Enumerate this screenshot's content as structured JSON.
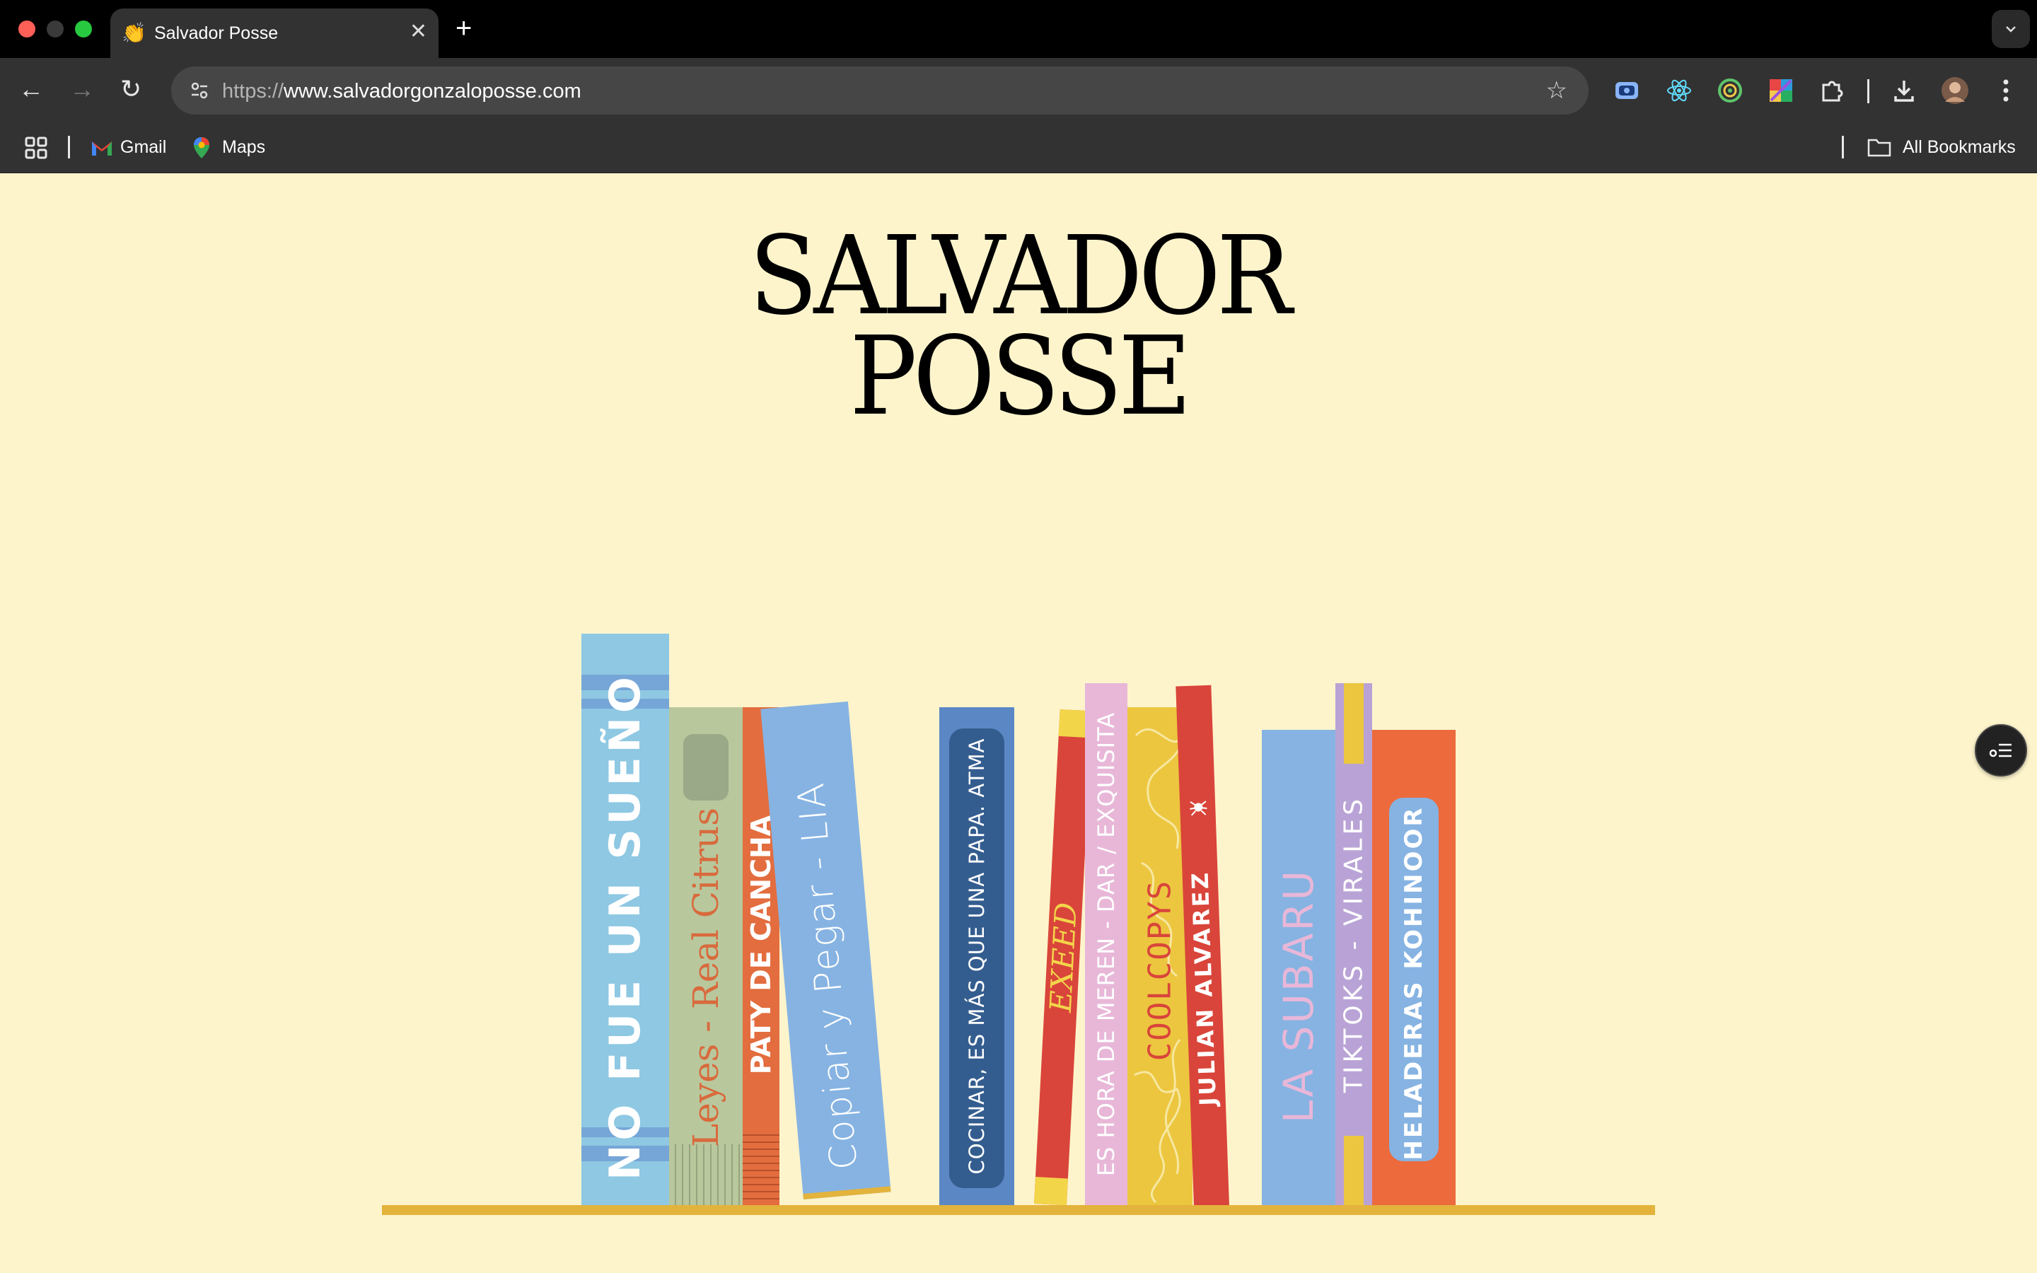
{
  "browser": {
    "tab_title": "Salvador Posse",
    "tab_favicon": "👏",
    "tab_close": "✕",
    "new_tab": "+",
    "tab_menu": "⌄",
    "url_scheme": "https://",
    "url_host": "www.salvadorgonzaloposse.com",
    "nav": {
      "back": "←",
      "forward": "→",
      "reload": "↻"
    },
    "star": "☆",
    "bookmarks": [
      {
        "label": "Gmail"
      },
      {
        "label": "Maps"
      }
    ],
    "all_bookmarks": "All Bookmarks",
    "extension_icons": [
      "screen-capture-icon",
      "react-devtools-icon",
      "circle-target-icon",
      "color-grid-icon",
      "puzzle-extensions-icon",
      "download-icon",
      "profile-avatar",
      "more-menu-icon"
    ]
  },
  "page": {
    "title_line1": "SALVADOR",
    "title_line2": "POSSE",
    "books": [
      {
        "label": "NO FUE UN SUEÑO",
        "color": "#8ec8e3",
        "text_color": "#ffffff"
      },
      {
        "label": "Leyes - Real Citrus",
        "color": "#b9c79d",
        "text_color": "#d86a3c"
      },
      {
        "label": "PATY DE CANCHA",
        "color": "#e36d3e",
        "text_color": "#ffffff"
      },
      {
        "label": "Copiar y Pegar - LIA",
        "color": "#86b3e2",
        "text_color": "#ffffff"
      },
      {
        "label": "COCINAR, ES MÁS QUE UNA PAPA. ATMA",
        "color": "#5b87c5",
        "text_color": "#ffffff"
      },
      {
        "label": "EXEED",
        "color": "#d9453a",
        "text_color": "#f3d54a"
      },
      {
        "label": "ES HORA DE MEREN - DAR / EXQUISITA",
        "color": "#e8b7d8",
        "text_color": "#ffffff"
      },
      {
        "label": "COOLCOPYS",
        "color": "#ecc63f",
        "text_color": "#d9453a"
      },
      {
        "label": "JULIAN ALVAREZ",
        "color": "#d9453a",
        "text_color": "#ffffff"
      },
      {
        "label": "LA SUBARU",
        "color": "#86b3e2",
        "text_color": "#e8b7d8"
      },
      {
        "label": "TIKTOKS - VIRALES",
        "color": "#b9a3d6",
        "text_color": "#ffffff"
      },
      {
        "label": "HELADERAS KOHINOOR",
        "color": "#ec6a3c",
        "text_color": "#ffffff"
      }
    ],
    "shelf_color": "#e3b33c",
    "background": "#fdf4cc"
  }
}
